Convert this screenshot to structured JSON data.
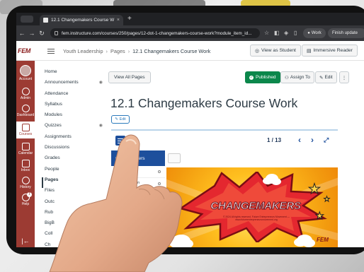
{
  "browser": {
    "tab_title": "12.1 Changemakers Course W",
    "tab_close": "×",
    "new_tab": "+",
    "url": "fem.instructure.com/courses/250/pages/12-dot-1-changemakers-course-work?module_item_id...",
    "work_label": "Work",
    "update_label": "Finish update"
  },
  "header": {
    "logo": "FEM",
    "breadcrumbs": [
      "Youth Leadership",
      "Pages",
      "12.1 Changemakers Course Work"
    ],
    "view_as_student": "View as Student",
    "immersive_reader": "Immersive Reader"
  },
  "global_nav": [
    {
      "label": "Account",
      "icon": "user-avatar"
    },
    {
      "label": "Admin",
      "icon": "shield-icon"
    },
    {
      "label": "Dashboard",
      "icon": "dashboard-icon"
    },
    {
      "label": "Courses",
      "icon": "book-icon"
    },
    {
      "label": "Calendar",
      "icon": "calendar-icon"
    },
    {
      "label": "Inbox",
      "icon": "inbox-icon"
    },
    {
      "label": "History",
      "icon": "clock-icon"
    },
    {
      "label": "Help",
      "icon": "help-icon",
      "badge": "7"
    }
  ],
  "course_nav": [
    {
      "label": "Home"
    },
    {
      "label": "Announcements",
      "hidden": true
    },
    {
      "label": "Attendance"
    },
    {
      "label": "Syllabus"
    },
    {
      "label": "Modules"
    },
    {
      "label": "Quizzes",
      "hidden": true
    },
    {
      "label": "Assignments"
    },
    {
      "label": "Discussions"
    },
    {
      "label": "Grades"
    },
    {
      "label": "People"
    },
    {
      "label": "Pages"
    },
    {
      "label": "Files"
    },
    {
      "label": "Outc"
    },
    {
      "label": "Rub"
    },
    {
      "label": "BigB"
    },
    {
      "label": "Coll"
    },
    {
      "label": "Ch"
    }
  ],
  "content": {
    "view_all_pages": "View All Pages",
    "published": "Published",
    "assign_to": "Assign To",
    "edit": "Edit",
    "more": "⋮",
    "title": "12.1 Changemakers Course Work",
    "edit_chip": "Edit"
  },
  "viewer": {
    "title_fragment": "A",
    "slide_count": "1 / 13",
    "sidebar_header": "O-",
    "sidebar_header_2": "kers",
    "sidebar_rows": [
      "",
      "tion",
      "ina",
      "e",
      ""
    ],
    "slide_title": "CHANGEMAKERS",
    "slide_subtitle": "© 2024 All rights reserved. Future Entrepreneurs Movement — www.futureentrepreneursmovement.org",
    "slide_logo": "FEM"
  },
  "colors": {
    "canvas_nav": "#9c3b33",
    "published": "#0b874b",
    "viewer_blue": "#1d4f9c",
    "slide_orange": "#f29a0e"
  }
}
